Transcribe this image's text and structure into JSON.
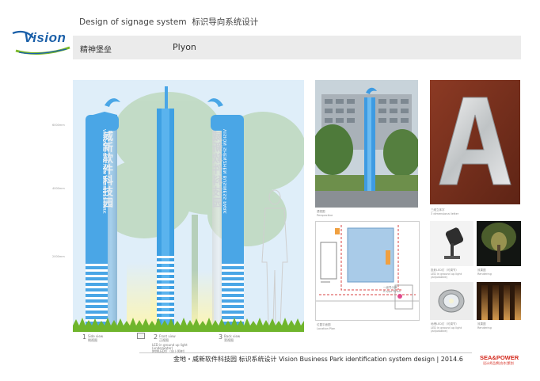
{
  "header": {
    "title_en": "Design of signage system",
    "title_cn": "标识导向系统设计",
    "band_cn": "精神堡垒",
    "band_en": "Plyon"
  },
  "logo": {
    "text": "Vision"
  },
  "elevation": {
    "scale_labels": [
      "6000mm",
      "4000mm",
      "2000mm"
    ],
    "pylon_text_cn": "威新软件科技园",
    "pylon_text_en": "VISION SHENZHEN BUSINESS PARK",
    "views": [
      {
        "num": "1",
        "label_en": "Side view",
        "label_cn": "侧视图"
      },
      {
        "num": "2",
        "label_en": "Front view",
        "label_cn": "正视图"
      },
      {
        "num": "3",
        "label_en": "Back view",
        "label_cn": "背视图"
      }
    ],
    "led_note_en": "LED in ground up light",
    "led_note_en2": "(underwater)",
    "led_note_cn": "地埋LED灯（向上照射）"
  },
  "photos": {
    "perspective_cap": "透视图",
    "perspective_cap_en": "Perspective",
    "letter_cap": "三维立体字",
    "letter_cap_en": "3 dimensional letter",
    "location_cap": "位置平面图",
    "location_cap_en": "Location Plan",
    "location_note": "一级导示牌",
    "location_note_en": "A-type Pylon",
    "light1_cap": "投射LED灯（可调节）",
    "light1_cap_en": "LED in ground up light (adjustable)",
    "effect1_cap": "效果图",
    "effect1_cap_en": "Rendering",
    "light2_cap": "地埋LED灯（可调节）",
    "light2_cap_en": "LED in ground up light (adjustable)",
    "effect2_cap": "效果图",
    "effect2_cap_en": "Rendering"
  },
  "footer": {
    "text": "金地・威新软件科技园 标识系统设计  Vision Business Park  identification system design | 2014.6",
    "brand": "SEA&POWER",
    "brand_sub": "设计师品牌|合作|策划"
  },
  "colors": {
    "pylon_blue": "#4aa6e6",
    "stripe": "#ffffff",
    "grass": "#6fb52c",
    "accent_red": "#d42a1e"
  }
}
